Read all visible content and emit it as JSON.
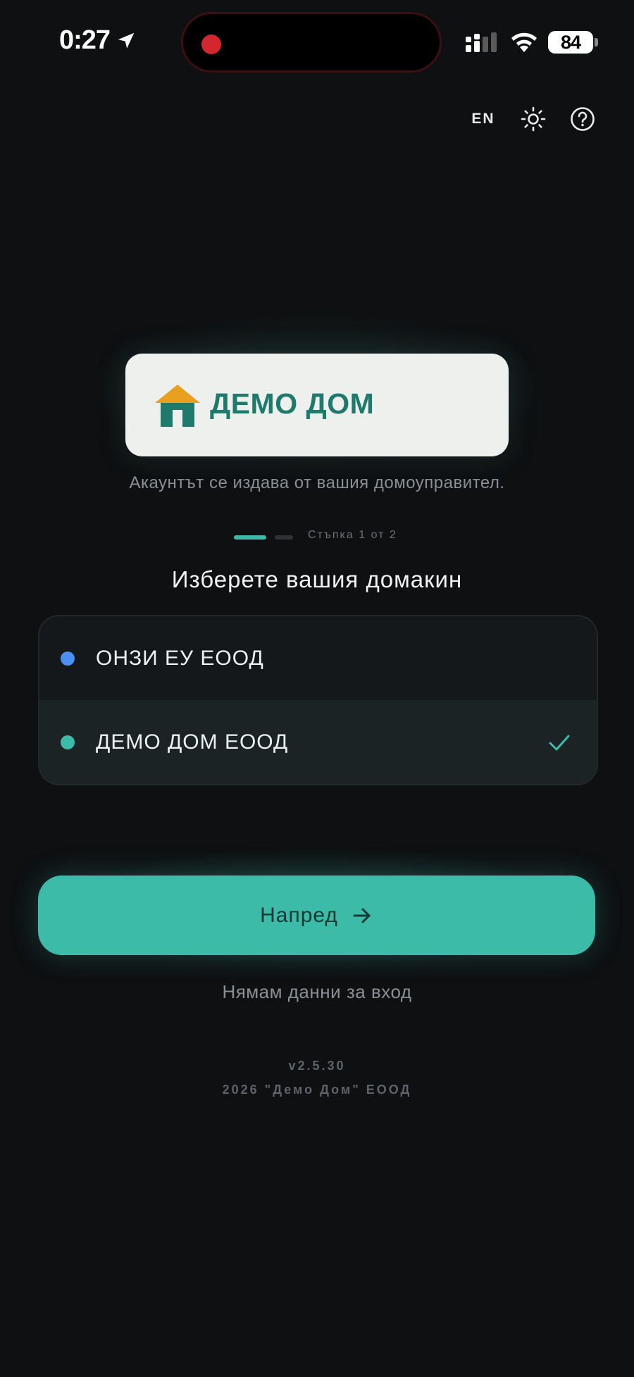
{
  "status_bar": {
    "time": "0:27",
    "battery": "84",
    "icons": [
      "location-arrow-icon",
      "recording-dot-icon",
      "cellular-signal-icon",
      "wifi-icon",
      "battery-icon"
    ]
  },
  "toolbar": {
    "language": "EN",
    "icons": [
      "sun-icon",
      "help-circle-icon"
    ]
  },
  "logo": {
    "text": "ДЕМО ДОМ",
    "icon": "house-icon"
  },
  "tagline": "Акаунтът се издава от вашия домоуправител.",
  "steps": {
    "label": "Стъпка 1 от 2",
    "current": 1,
    "total": 2
  },
  "section_title": "Изберете вашия домакин",
  "hosts": [
    {
      "name": "ОНЗИ ЕУ ЕООД",
      "dot_color": "#4a90f0",
      "selected": false
    },
    {
      "name": "ДЕМО ДОМ ЕООД",
      "dot_color": "#3dbba9",
      "selected": true
    }
  ],
  "next_button": {
    "label": "Напред",
    "icon": "arrow-right-icon"
  },
  "no_login_link": "Нямам данни за вход",
  "footer": {
    "version": "v2.5.30",
    "copyright": "2026 \"Демо Дом\" ЕООД"
  },
  "colors": {
    "background": "#0e1012",
    "accent": "#3dbba9",
    "brand_green": "#1e7a6b",
    "brand_orange": "#e8a020"
  }
}
